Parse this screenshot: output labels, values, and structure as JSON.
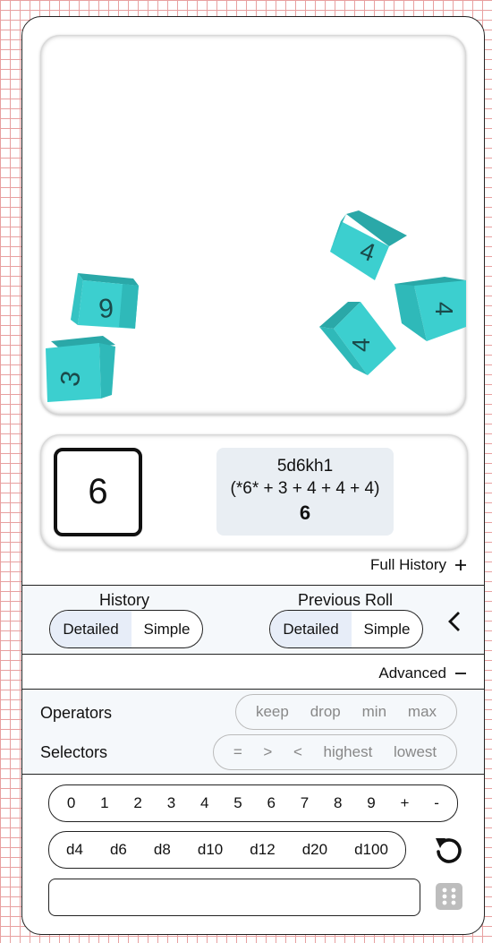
{
  "stage": {
    "dice": [
      {
        "face": "9",
        "color": "#3ccfcf"
      },
      {
        "face": "3",
        "color": "#3ccfcf"
      },
      {
        "face": "4",
        "color": "#3ccfcf"
      },
      {
        "face": "4",
        "color": "#3ccfcf"
      },
      {
        "face": "4",
        "color": "#3ccfcf"
      }
    ]
  },
  "result": {
    "value": "6",
    "notation": "5d6kh1",
    "breakdown": "(*6* + 3 + 4 + 4 + 4)",
    "total": "6"
  },
  "full_history": {
    "label": "Full History",
    "icon": "plus-icon"
  },
  "display_options": {
    "history": {
      "label": "History",
      "options": [
        "Detailed",
        "Simple"
      ],
      "selected": "Detailed"
    },
    "previous_roll": {
      "label": "Previous Roll",
      "options": [
        "Detailed",
        "Simple"
      ],
      "selected": "Detailed"
    },
    "collapse_icon": "chevron-left-icon"
  },
  "advanced": {
    "label": "Advanced",
    "icon": "minus-icon"
  },
  "operators": {
    "label": "Operators",
    "items": [
      "keep",
      "drop",
      "min",
      "max"
    ]
  },
  "selectors": {
    "label": "Selectors",
    "items": [
      "=",
      ">",
      "<",
      "highest",
      "lowest"
    ]
  },
  "keypad": {
    "digits": [
      "0",
      "1",
      "2",
      "3",
      "4",
      "5",
      "6",
      "7",
      "8",
      "9",
      "+",
      "-"
    ],
    "dice": [
      "d4",
      "d6",
      "d8",
      "d10",
      "d12",
      "d20",
      "d100"
    ]
  },
  "colors": {
    "accent": "#e7edf8",
    "die": "#3ccfcf",
    "panel": "#f5f8fb"
  }
}
